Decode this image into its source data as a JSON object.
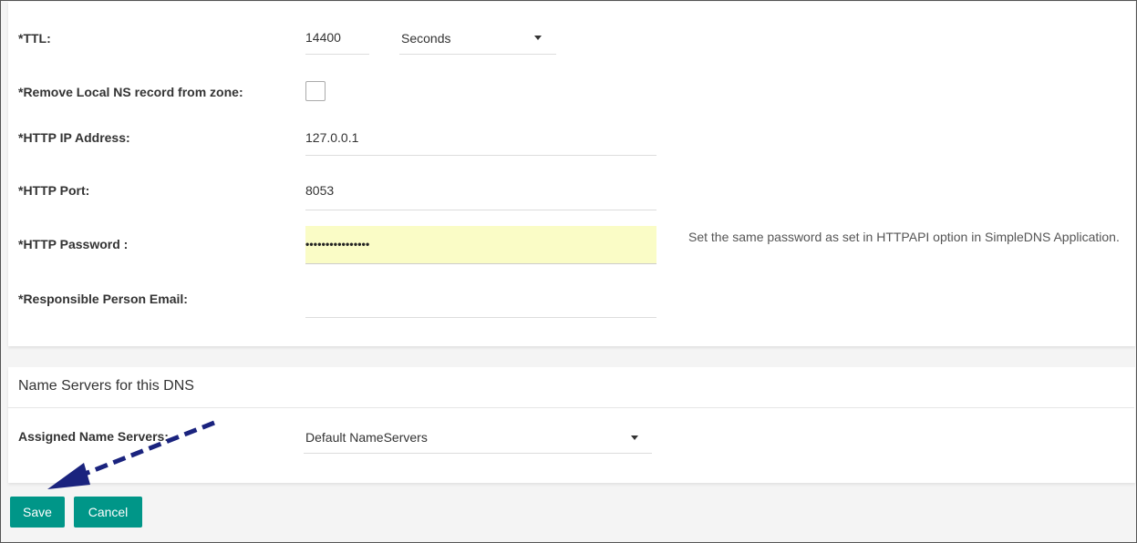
{
  "form": {
    "ttl": {
      "label": "*TTL:",
      "value": "14400",
      "unit_selected": "Seconds"
    },
    "remove_local_ns": {
      "label": "*Remove Local NS record from zone:",
      "checked": false
    },
    "http_ip": {
      "label": "*HTTP IP Address:",
      "value": "127.0.0.1"
    },
    "http_port": {
      "label": "*HTTP Port:",
      "value": "8053"
    },
    "http_password": {
      "label": "*HTTP Password :",
      "masked_value": "••••••••••••••••",
      "help": "Set the same password as set in HTTPAPI option in SimpleDNS Application."
    },
    "responsible_email": {
      "label": "*Responsible Person Email:",
      "value": ""
    }
  },
  "name_servers": {
    "title": "Name Servers for this DNS",
    "assigned_label": "Assigned Name Servers:",
    "selected": "Default NameServers"
  },
  "actions": {
    "save_label": "Save",
    "cancel_label": "Cancel"
  },
  "colors": {
    "button": "#009688",
    "autofill": "#fafcc6",
    "annotation_arrow": "#1a237e"
  },
  "icons": {
    "dropdown": "chevron-down-icon",
    "annotation": "dashed-arrow-icon"
  }
}
